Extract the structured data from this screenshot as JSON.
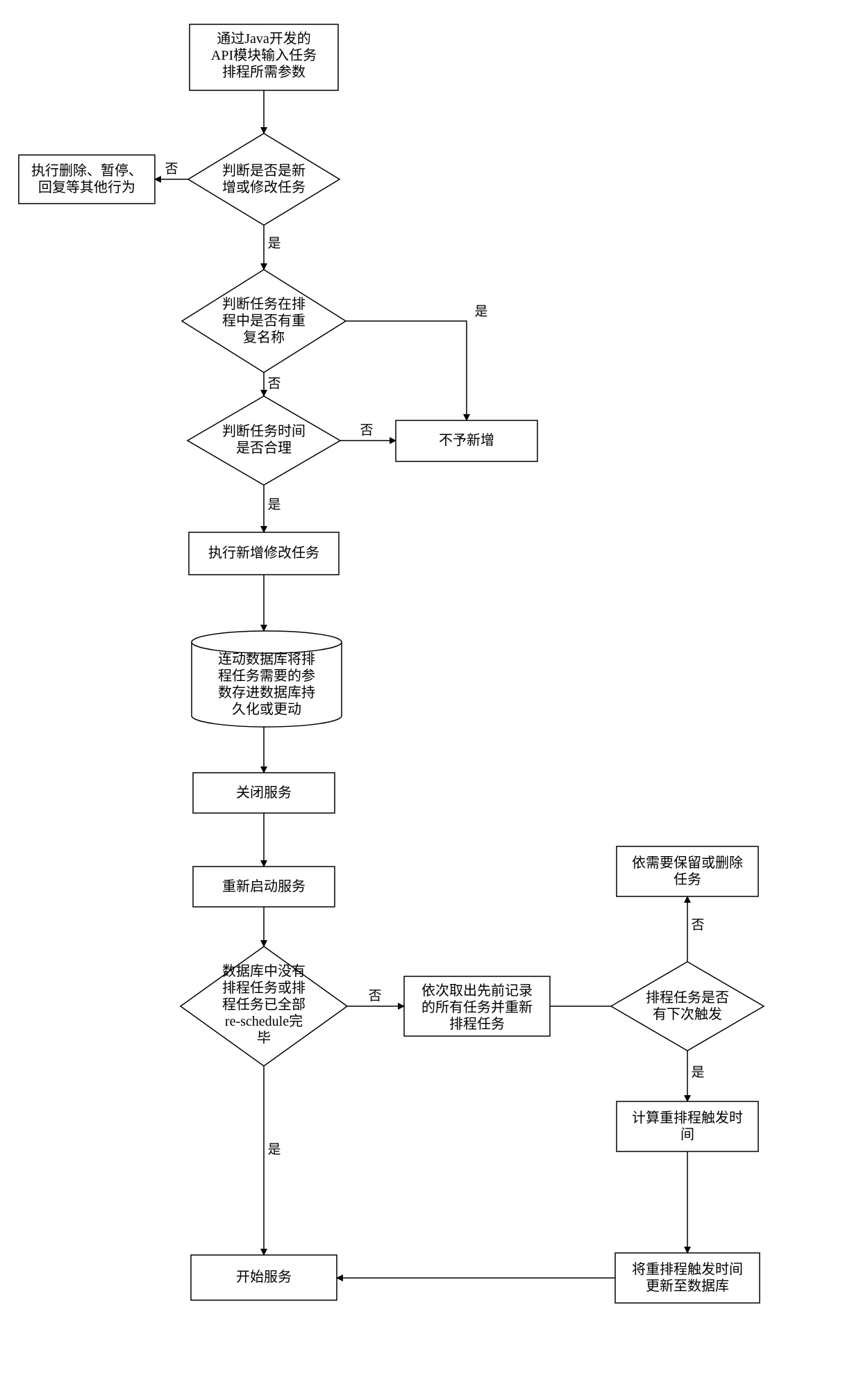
{
  "nodes": {
    "n1": {
      "l1": "通过Java开发的",
      "l2": "API模块输入任务",
      "l3": "排程所需参数"
    },
    "n2": {
      "l1": "判断是否是新",
      "l2": "增或修改任务"
    },
    "n3": {
      "l1": "执行删除、暂停、",
      "l2": "回复等其他行为"
    },
    "n4": {
      "l1": "判断任务在排",
      "l2": "程中是否有重",
      "l3": "复名称"
    },
    "n5": {
      "l1": "判断任务时间",
      "l2": "是否合理"
    },
    "n6": {
      "l1": "不予新增"
    },
    "n7": {
      "l1": "执行新增修改任务"
    },
    "n8": {
      "l1": "连动数据库将排",
      "l2": "程任务需要的参",
      "l3": "数存进数据库持",
      "l4": "久化或更动"
    },
    "n9": {
      "l1": "关闭服务"
    },
    "n10": {
      "l1": "重新启动服务"
    },
    "n11": {
      "l1": "数据库中没有",
      "l2": "排程任务或排",
      "l3": "程任务已全部",
      "l4": "re-schedule完",
      "l5": "毕"
    },
    "n12": {
      "l1": "依次取出先前记录",
      "l2": "的所有任务并重新",
      "l3": "排程任务"
    },
    "n13": {
      "l1": "排程任务是否",
      "l2": "有下次触发"
    },
    "n14": {
      "l1": "依需要保留或删除",
      "l2": "任务"
    },
    "n15": {
      "l1": "计算重排程触发时",
      "l2": "间"
    },
    "n16": {
      "l1": "将重排程触发时间",
      "l2": "更新至数据库"
    },
    "n17": {
      "l1": "开始服务"
    }
  },
  "labels": {
    "yes": "是",
    "no": "否"
  }
}
